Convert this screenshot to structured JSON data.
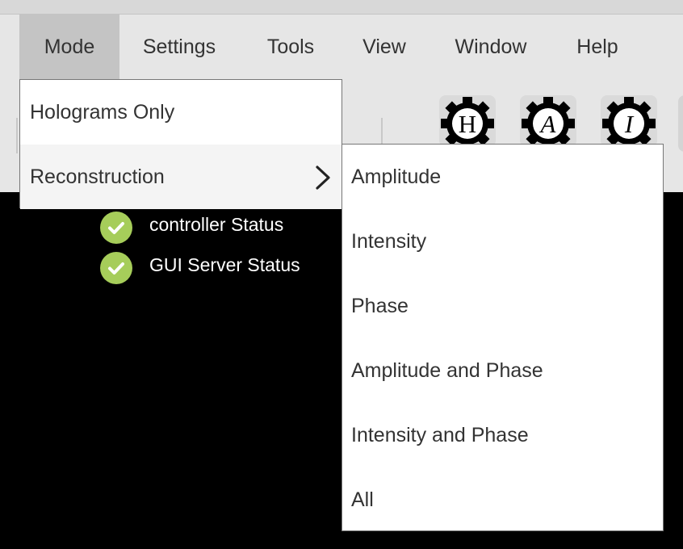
{
  "menubar": {
    "items": [
      {
        "label": "Mode",
        "active": true
      },
      {
        "label": "Settings"
      },
      {
        "label": "Tools"
      },
      {
        "label": "View"
      },
      {
        "label": "Window"
      },
      {
        "label": "Help"
      }
    ]
  },
  "toolbar": {
    "buttons": [
      {
        "letter": "H",
        "icon": "gear-h-icon"
      },
      {
        "letter": "A",
        "icon": "gear-a-icon"
      },
      {
        "letter": "I",
        "icon": "gear-i-icon"
      }
    ]
  },
  "status": {
    "items": [
      {
        "label": "controller Status",
        "icon": "check-circle-icon"
      },
      {
        "label": "GUI Server Status",
        "icon": "check-circle-icon"
      }
    ]
  },
  "mode_menu": {
    "items": [
      {
        "label": "Holograms Only"
      },
      {
        "label": "Reconstruction",
        "has_submenu": true,
        "highlighted": true
      }
    ]
  },
  "reconstruction_submenu": {
    "items": [
      {
        "label": "Amplitude"
      },
      {
        "label": "Intensity"
      },
      {
        "label": "Phase"
      },
      {
        "label": "Amplitude and Phase"
      },
      {
        "label": "Intensity and Phase"
      },
      {
        "label": "All"
      }
    ]
  },
  "colors": {
    "menubar_bg": "#e6e6e6",
    "active_menu_bg": "#c4c4c4",
    "status_ok": "#a6cd5a",
    "canvas_bg": "#000000"
  }
}
